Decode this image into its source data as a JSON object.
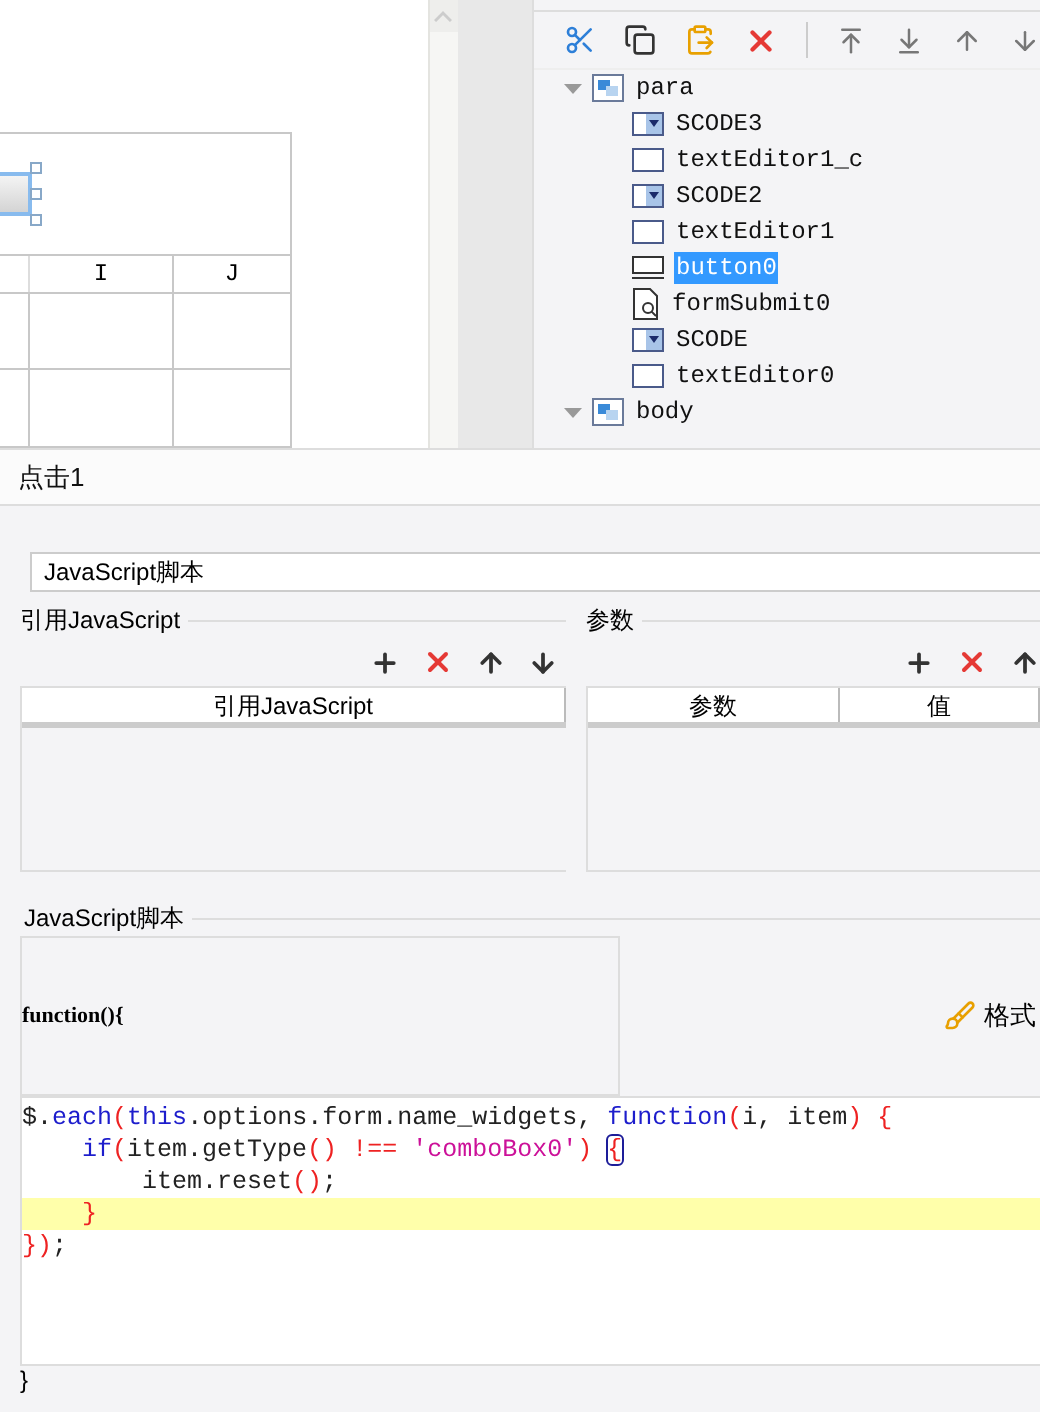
{
  "canvas": {
    "column_headers": [
      "I",
      "J"
    ]
  },
  "tree": {
    "nodes": [
      {
        "label": "para",
        "kind": "container",
        "expanded": true,
        "selected": false,
        "children": [
          {
            "label": "SCODE3",
            "kind": "combo",
            "selected": false
          },
          {
            "label": "textEditor1_c",
            "kind": "text",
            "selected": false
          },
          {
            "label": "SCODE2",
            "kind": "combo",
            "selected": false
          },
          {
            "label": "textEditor1",
            "kind": "text",
            "selected": false
          },
          {
            "label": "button0",
            "kind": "button",
            "selected": true
          },
          {
            "label": "formSubmit0",
            "kind": "form",
            "selected": false
          },
          {
            "label": "SCODE",
            "kind": "combo",
            "selected": false
          },
          {
            "label": "textEditor0",
            "kind": "text",
            "selected": false
          }
        ]
      },
      {
        "label": "body",
        "kind": "container",
        "expanded": true,
        "selected": false
      }
    ]
  },
  "tab": {
    "label": "点击1"
  },
  "action_type": {
    "value": "JavaScript脚本"
  },
  "imports": {
    "legend": "引用JavaScript",
    "columns": [
      "引用JavaScript"
    ]
  },
  "params": {
    "legend": "参数",
    "columns": [
      "参数",
      "值"
    ]
  },
  "script": {
    "legend": "JavaScript脚本",
    "header": "function(){",
    "format_button": "格式",
    "footer": "}",
    "lines": [
      {
        "highlighted": false,
        "tokens": [
          {
            "kind": "plain",
            "text": "$."
          },
          {
            "kind": "keyword",
            "text": "each"
          },
          {
            "kind": "bracket",
            "text": "("
          },
          {
            "kind": "keyword",
            "text": "this"
          },
          {
            "kind": "plain",
            "text": ".options.form.name_widgets, "
          },
          {
            "kind": "keyword",
            "text": "function"
          },
          {
            "kind": "bracket",
            "text": "("
          },
          {
            "kind": "plain",
            "text": "i, item"
          },
          {
            "kind": "bracket",
            "text": ")"
          },
          {
            "kind": "bracket",
            "text": " {"
          }
        ]
      },
      {
        "highlighted": false,
        "tokens": [
          {
            "kind": "keyword",
            "text": "    if"
          },
          {
            "kind": "bracket",
            "text": "("
          },
          {
            "kind": "plain",
            "text": "item.getType"
          },
          {
            "kind": "bracket",
            "text": "()"
          },
          {
            "kind": "operator",
            "text": " !== "
          },
          {
            "kind": "string",
            "text": "'comboBox0'"
          },
          {
            "kind": "bracket",
            "text": ") "
          },
          {
            "kind": "matched-bracket",
            "text": "{"
          }
        ]
      },
      {
        "highlighted": false,
        "tokens": [
          {
            "kind": "plain",
            "text": "        item.reset"
          },
          {
            "kind": "bracket",
            "text": "()"
          },
          {
            "kind": "plain",
            "text": ";"
          }
        ]
      },
      {
        "highlighted": true,
        "tokens": [
          {
            "kind": "bracket",
            "text": "    }"
          }
        ]
      },
      {
        "highlighted": false,
        "tokens": [
          {
            "kind": "bracket",
            "text": "})"
          },
          {
            "kind": "plain",
            "text": ";"
          }
        ]
      }
    ]
  }
}
